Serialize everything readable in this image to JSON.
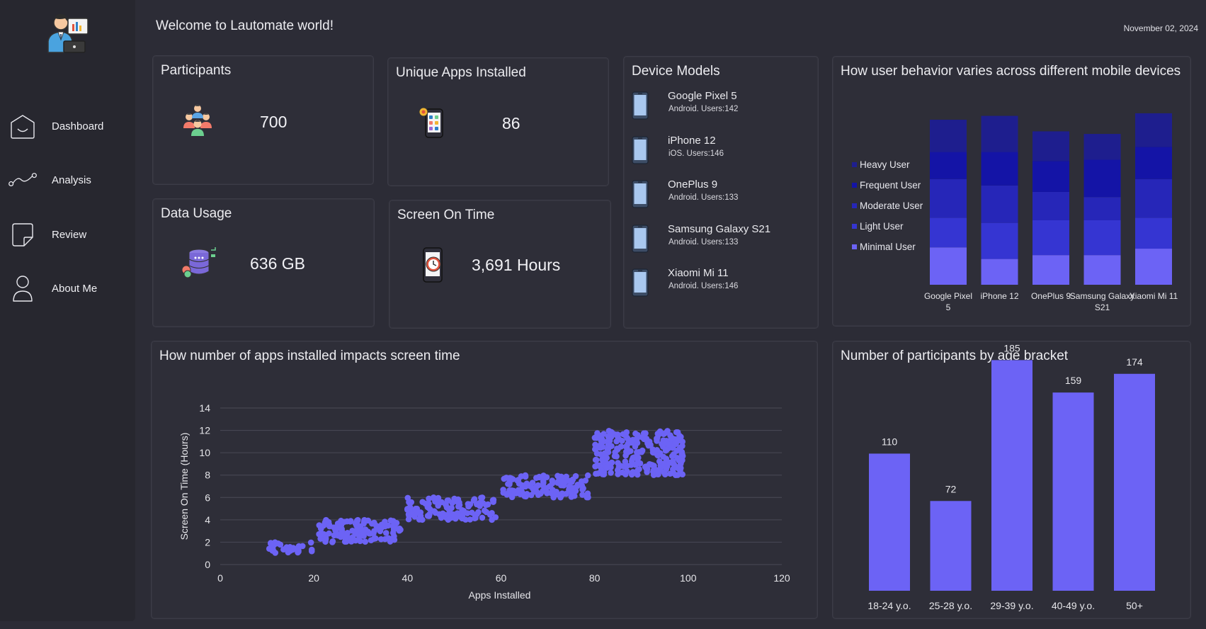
{
  "header": {
    "welcome": "Welcome to Lautomate world!",
    "date": "November 02, 2024"
  },
  "sidebar": {
    "items": [
      {
        "label": "Dashboard",
        "icon": "home-icon"
      },
      {
        "label": "Analysis",
        "icon": "analysis-line-icon"
      },
      {
        "label": "Review",
        "icon": "note-icon"
      },
      {
        "label": "About Me",
        "icon": "person-icon"
      }
    ]
  },
  "kpis": {
    "participants": {
      "title": "Participants",
      "value": "700",
      "icon": "group-people-icon"
    },
    "apps": {
      "title": "Unique Apps Installed",
      "value": "86",
      "icon": "phone-apps-icon"
    },
    "data": {
      "title": "Data Usage",
      "value": "636 GB",
      "icon": "database-icon"
    },
    "screen": {
      "title": "Screen On Time",
      "value": "3,691 Hours",
      "icon": "phone-clock-icon"
    }
  },
  "devices": {
    "title": "Device Models",
    "items": [
      {
        "name": "Google Pixel 5",
        "sub": "Android. Users:142"
      },
      {
        "name": "iPhone 12",
        "sub": "iOS. Users:146"
      },
      {
        "name": "OnePlus 9",
        "sub": "Android. Users:133"
      },
      {
        "name": "Samsung Galaxy S21",
        "sub": "Android. Users:133"
      },
      {
        "name": "Xiaomi Mi 11",
        "sub": "Android. Users:146"
      }
    ]
  },
  "colors": {
    "accent": "#6c63f5",
    "heavy": "#1e1e8e",
    "frequent": "#1414a6",
    "moderate": "#2626b8",
    "light": "#3535d2",
    "minimal": "#6c63f5"
  },
  "chart_data": [
    {
      "type": "bar",
      "stacked": true,
      "title": "How user behavior varies across different mobile devices",
      "categories": [
        "Google Pixel 5",
        "iPhone 12",
        "OnePlus 9",
        "Samsung Galaxy S21",
        "Xiaomi Mi 11"
      ],
      "legend_position": "left",
      "series": [
        {
          "name": "Minimal User",
          "values": [
            29,
            20,
            23,
            23,
            28
          ]
        },
        {
          "name": "Light User",
          "values": [
            23,
            28,
            27,
            27,
            24
          ]
        },
        {
          "name": "Moderate User",
          "values": [
            30,
            29,
            22,
            18,
            30
          ]
        },
        {
          "name": "Frequent User",
          "values": [
            21,
            26,
            24,
            29,
            25
          ]
        },
        {
          "name": "Heavy User",
          "values": [
            25,
            28,
            23,
            20,
            26
          ]
        }
      ]
    },
    {
      "type": "scatter",
      "title": "How number of apps installed impacts screen time",
      "xlabel": "Apps Installed",
      "ylabel": "Screen On Time (Hours)",
      "xlim": [
        0,
        120
      ],
      "ylim": [
        0,
        14
      ],
      "xticks": [
        0,
        20,
        40,
        60,
        80,
        100,
        120
      ],
      "yticks": [
        0,
        2,
        4,
        6,
        8,
        10,
        12,
        14
      ],
      "grid": true,
      "clusters": [
        {
          "x": [
            10,
            20
          ],
          "y": [
            1.0,
            2.0
          ]
        },
        {
          "x": [
            21,
            39
          ],
          "y": [
            2.0,
            4.0
          ]
        },
        {
          "x": [
            40,
            59
          ],
          "y": [
            4.0,
            6.0
          ]
        },
        {
          "x": [
            60,
            79
          ],
          "y": [
            6.0,
            8.0
          ]
        },
        {
          "x": [
            80,
            99
          ],
          "y": [
            8.0,
            12.0
          ]
        }
      ]
    },
    {
      "type": "bar",
      "title": "Number of participants by age bracket",
      "categories": [
        "18-24 y.o.",
        "25-28 y.o.",
        "29-39 y.o.",
        "40-49 y.o.",
        "50+"
      ],
      "values": [
        110,
        72,
        185,
        159,
        174
      ],
      "data_labels": true
    }
  ]
}
